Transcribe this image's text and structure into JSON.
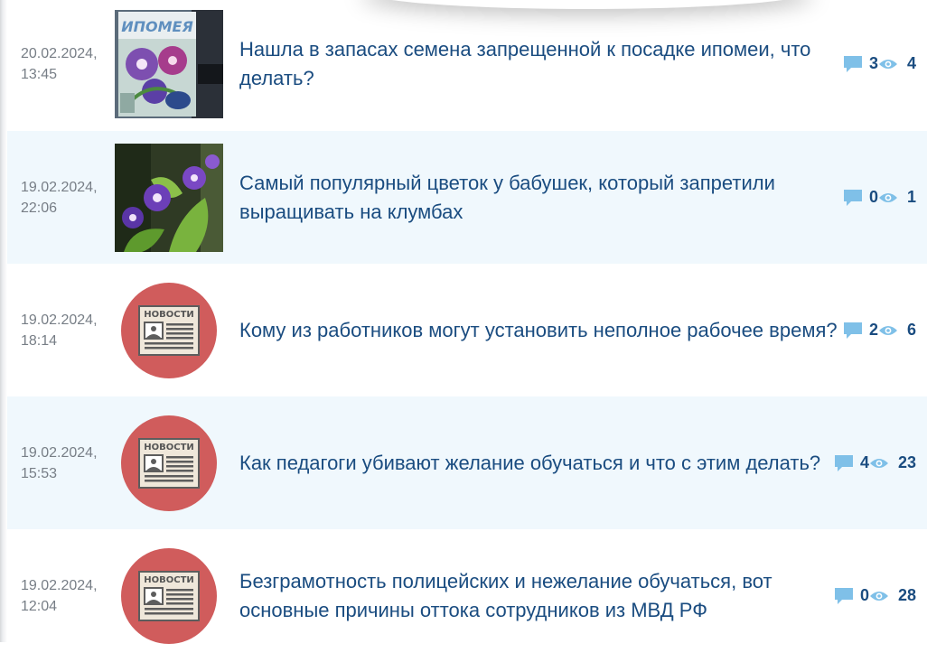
{
  "colors": {
    "title": "#1a4c80",
    "date": "#777e86",
    "row_alt_bg": "#f0f8fd",
    "news_badge_bg": "#d05c5c",
    "icon_blue": "#7fc0e8"
  },
  "news_badge": {
    "label": "НОВОСТИ"
  },
  "items": [
    {
      "date": "20.02.2024,",
      "time": "13:45",
      "title": "Нашла в запасах семена запрещенной к посадке ипомеи, что делать?",
      "comments": "3",
      "views": "4",
      "thumb": "seed-packet",
      "thumb_text": "ИПОМЕЯ"
    },
    {
      "date": "19.02.2024,",
      "time": "22:06",
      "title": "Самый популярный цветок у бабушек, который запретили выращивать на клумбах",
      "comments": "0",
      "views": "1",
      "thumb": "flower-photo"
    },
    {
      "date": "19.02.2024,",
      "time": "18:14",
      "title": "Кому из работников могут установить неполное рабочее время?",
      "comments": "2",
      "views": "6",
      "thumb": "news-badge"
    },
    {
      "date": "19.02.2024,",
      "time": "15:53",
      "title": "Как педагоги убивают желание обучаться и что с этим делать?",
      "comments": "4",
      "views": "23",
      "thumb": "news-badge"
    },
    {
      "date": "19.02.2024,",
      "time": "12:04",
      "title": "Безграмотность полицейских и нежелание обучаться, вот основные причины оттока сотрудников из МВД РФ",
      "comments": "0",
      "views": "28",
      "thumb": "news-badge"
    }
  ]
}
